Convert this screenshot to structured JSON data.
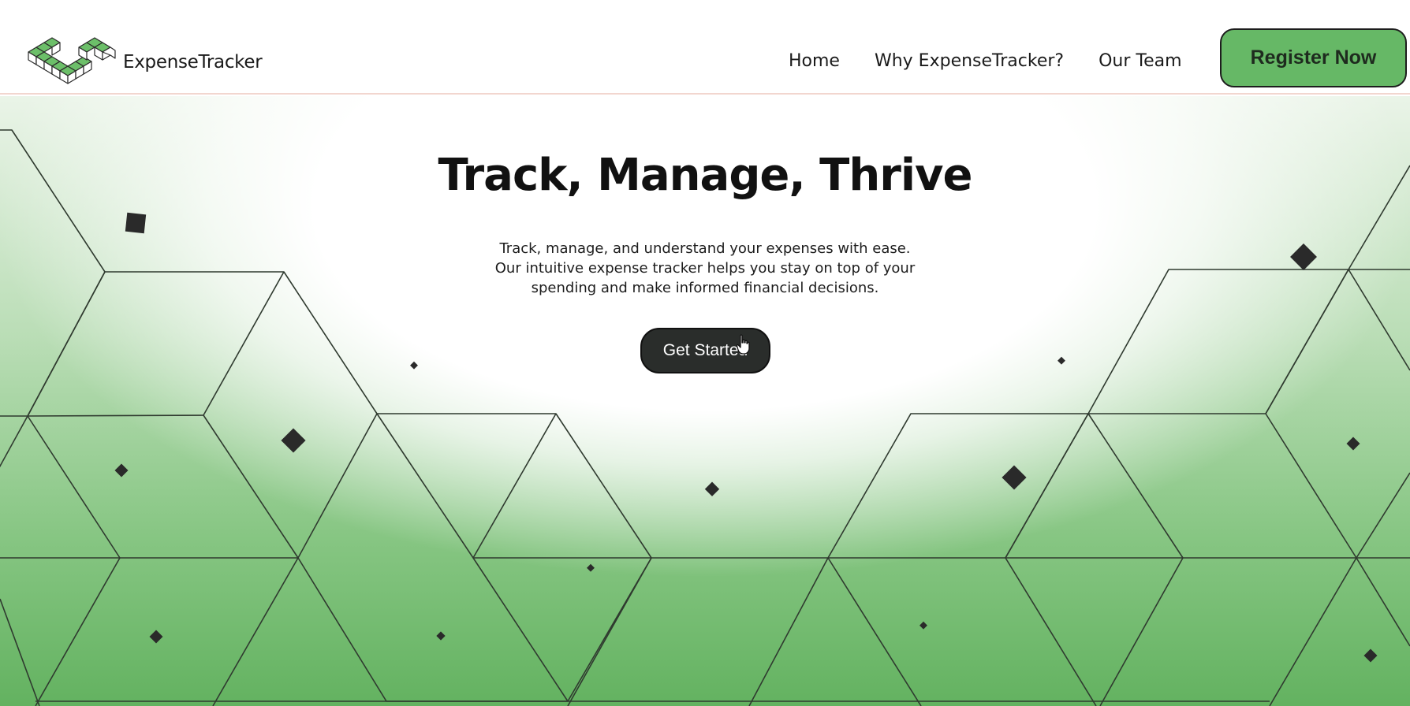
{
  "navbar": {
    "brand_name": "ExpenseTracker",
    "logo_icon": "cubes-logo-icon",
    "links": [
      "Home",
      "Why ExpenseTracker?",
      "Our Team"
    ],
    "register_label": "Register Now"
  },
  "hero": {
    "title": "Track, Manage, Thrive",
    "description_lines": [
      "Track, manage, and understand your expenses with ease.",
      "Our intuitive expense tracker helps you stay on top of your",
      "spending and make informed financial decisions."
    ],
    "cta_label": "Get Started",
    "background_pattern": "hexagon-cube-grid",
    "cursor_icon": "hand-pointer-icon"
  },
  "colors": {
    "accent_green": "#66b866",
    "button_dark": "#2a2d2b",
    "nav_border": "#f2d6cf",
    "text_dark": "#111111"
  }
}
